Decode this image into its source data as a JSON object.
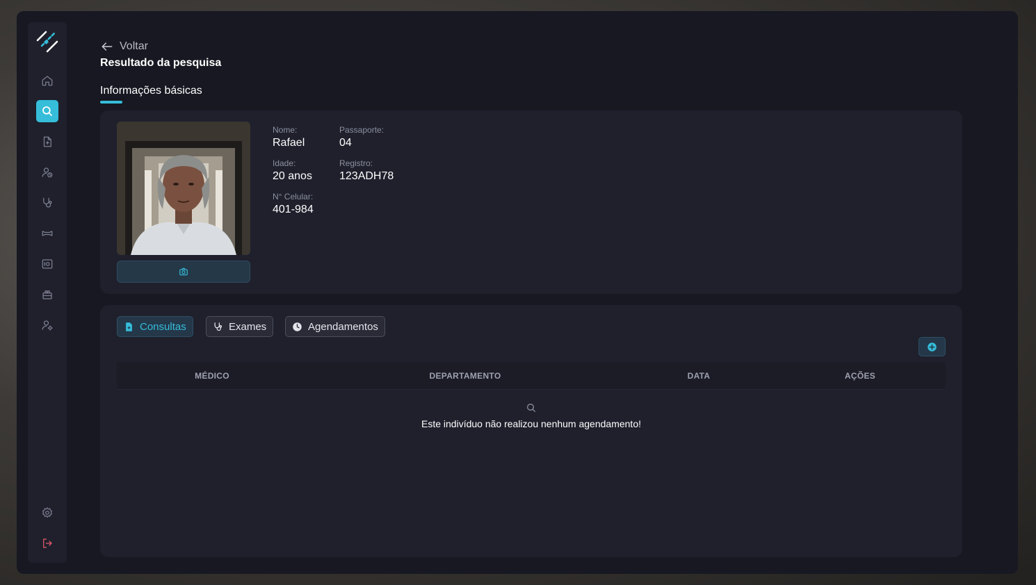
{
  "nav": {
    "back_label": "Voltar",
    "page_title": "Resultado da pesquisa",
    "section_tab": "Informações básicas"
  },
  "sidebar": {
    "items": [
      {
        "name": "home-icon",
        "active": false
      },
      {
        "name": "search-icon",
        "active": true
      },
      {
        "name": "document-icon",
        "active": false
      },
      {
        "name": "user-clock-icon",
        "active": false
      },
      {
        "name": "stethoscope-icon",
        "active": false
      },
      {
        "name": "bandage-icon",
        "active": false
      },
      {
        "name": "xray-icon",
        "active": false
      },
      {
        "name": "medkit-icon",
        "active": false
      },
      {
        "name": "user-settings-icon",
        "active": false
      }
    ],
    "bottom": [
      {
        "name": "settings-icon"
      },
      {
        "name": "logout-icon"
      }
    ]
  },
  "profile": {
    "name_label": "Nome:",
    "name": "Rafael",
    "passport_label": "Passaporte:",
    "passport": "04",
    "age_label": "Idade:",
    "age": "20 anos",
    "registry_label": "Registro:",
    "registry": "123ADH78",
    "phone_label": "N° Celular:",
    "phone": "401-984",
    "photo_button_icon": "camera-icon"
  },
  "records": {
    "tabs": [
      {
        "label": "Consultas",
        "icon": "document-icon",
        "active": true
      },
      {
        "label": "Exames",
        "icon": "stethoscope-icon",
        "active": false
      },
      {
        "label": "Agendamentos",
        "icon": "clock-icon",
        "active": false
      }
    ],
    "add_button_icon": "plus-circle-icon",
    "columns": [
      "MÉDICO",
      "DEPARTAMENTO",
      "DATA",
      "AÇÕES"
    ],
    "rows": [],
    "empty_message": "Este indivíduo não realizou nenhum agendamento!"
  },
  "colors": {
    "accent": "#35bdd9",
    "background": "#171821",
    "card": "#1f202c",
    "danger": "#e2596b"
  }
}
